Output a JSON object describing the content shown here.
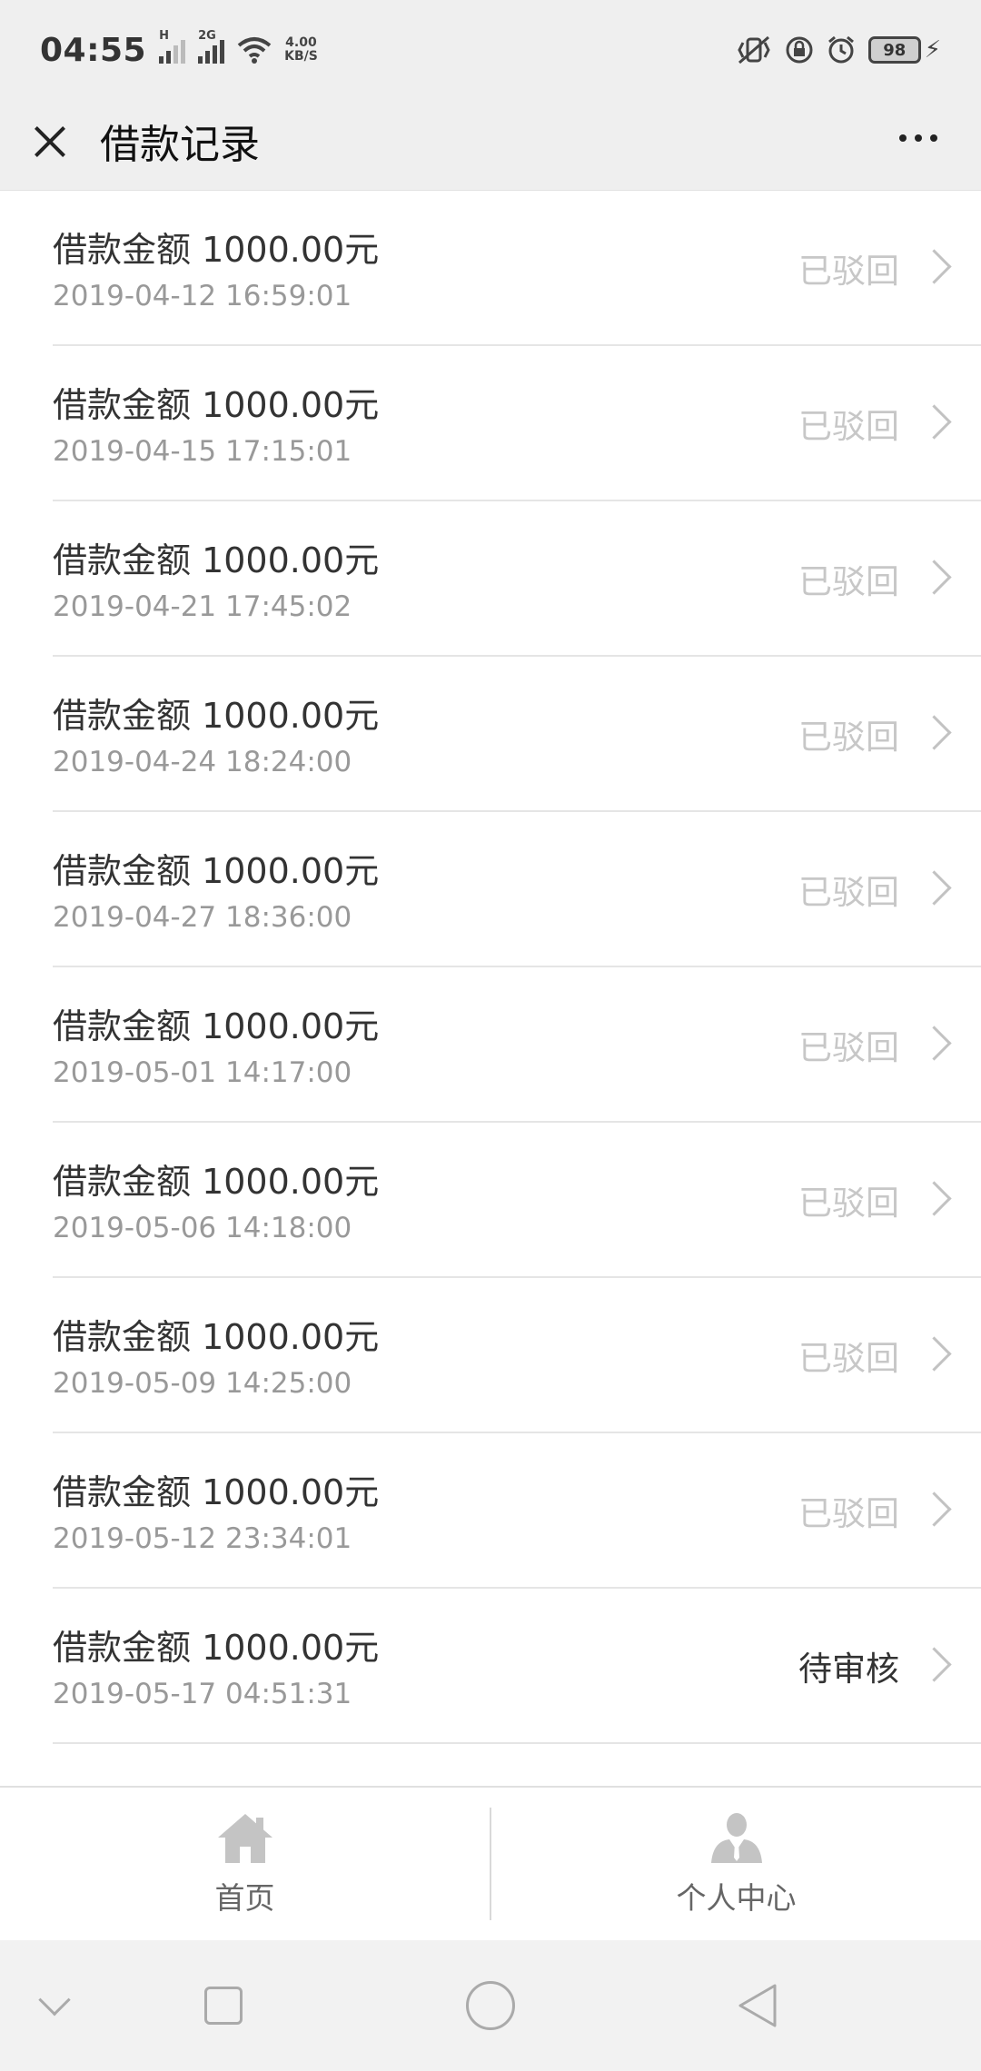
{
  "status_bar": {
    "time": "04:55",
    "signal1_tag": "H",
    "signal2_tag": "2G",
    "speed_value": "4.00",
    "speed_unit": "KB/S",
    "battery_level": "98"
  },
  "nav": {
    "title": "借款记录",
    "close_icon": "close-icon",
    "more_icon": "more-icon"
  },
  "records": [
    {
      "amount": "借款金额 1000.00元",
      "time": "2019-04-12 16:59:01",
      "status": "已驳回"
    },
    {
      "amount": "借款金额 1000.00元",
      "time": "2019-04-15 17:15:01",
      "status": "已驳回"
    },
    {
      "amount": "借款金额 1000.00元",
      "time": "2019-04-21 17:45:02",
      "status": "已驳回"
    },
    {
      "amount": "借款金额 1000.00元",
      "time": "2019-04-24 18:24:00",
      "status": "已驳回"
    },
    {
      "amount": "借款金额 1000.00元",
      "time": "2019-04-27 18:36:00",
      "status": "已驳回"
    },
    {
      "amount": "借款金额 1000.00元",
      "time": "2019-05-01 14:17:00",
      "status": "已驳回"
    },
    {
      "amount": "借款金额 1000.00元",
      "time": "2019-05-06 14:18:00",
      "status": "已驳回"
    },
    {
      "amount": "借款金额 1000.00元",
      "time": "2019-05-09 14:25:00",
      "status": "已驳回"
    },
    {
      "amount": "借款金额 1000.00元",
      "time": "2019-05-12 23:34:01",
      "status": "已驳回"
    },
    {
      "amount": "借款金额 1000.00元",
      "time": "2019-05-17 04:51:31",
      "status": "待审核"
    }
  ],
  "tabs": [
    {
      "label": "首页",
      "icon": "home-icon"
    },
    {
      "label": "个人中心",
      "icon": "user-icon"
    }
  ],
  "colors": {
    "status_rejected": "#c7c7c7",
    "status_pending": "#333333",
    "tab_icon": "#c4c4c4"
  }
}
